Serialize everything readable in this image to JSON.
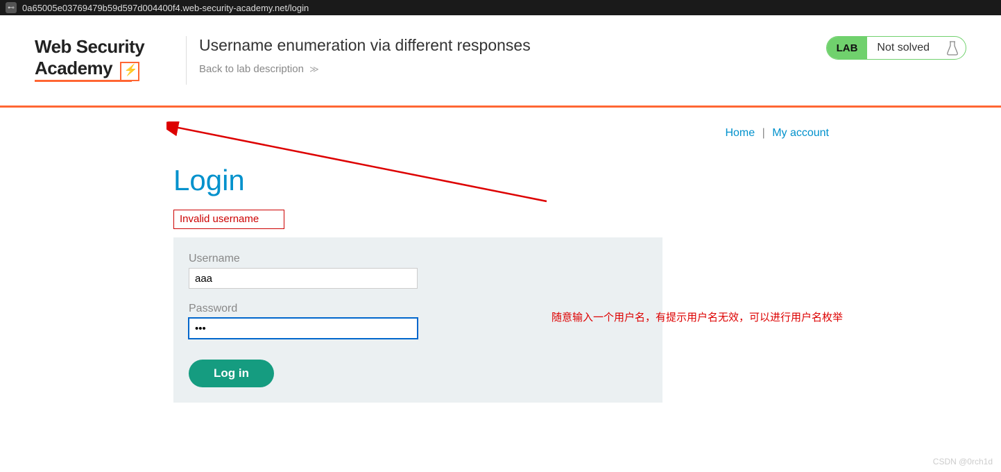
{
  "address_bar": {
    "url": "0a65005e03769479b59d597d004400f4.web-security-academy.net/login"
  },
  "logo": {
    "line1": "Web Security",
    "line2": "Academy"
  },
  "lab": {
    "title": "Username enumeration via different responses",
    "back_link": "Back to lab description",
    "badge": "LAB",
    "status": "Not solved"
  },
  "nav": {
    "home": "Home",
    "sep": "|",
    "account": "My account"
  },
  "login": {
    "heading": "Login",
    "error": "Invalid username",
    "username_label": "Username",
    "username_value": "aaa",
    "password_label": "Password",
    "password_value": "•••",
    "button": "Log in"
  },
  "annotation": "随意输入一个用户名，有提示用户名无效，可以进行用户名枚举",
  "watermark": "CSDN @0rch1d"
}
